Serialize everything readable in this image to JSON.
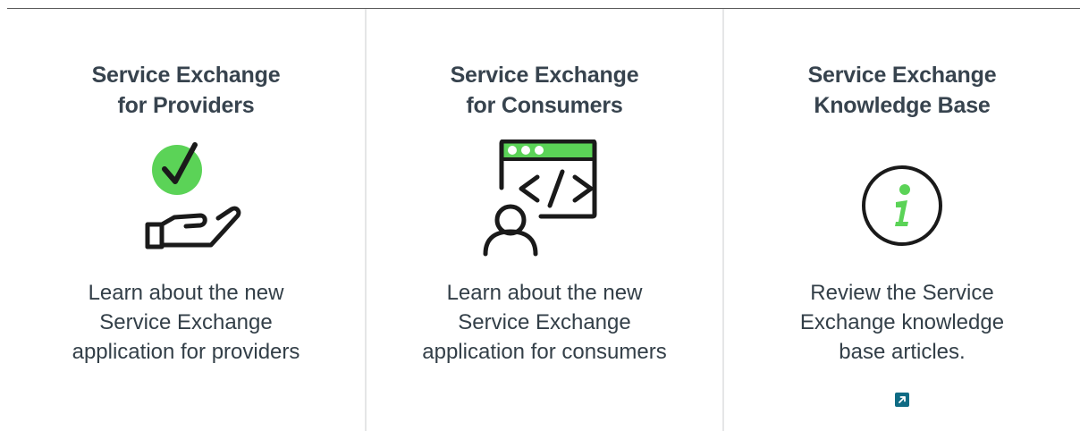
{
  "cards": [
    {
      "title_line1": "Service Exchange",
      "title_line2": "for Providers",
      "icon": "hand-checkmark-icon",
      "description_line1": "Learn about the new",
      "description_line2": "Service Exchange",
      "description_line3": "application for providers"
    },
    {
      "title_line1": "Service Exchange",
      "title_line2": "for Consumers",
      "icon": "code-window-user-icon",
      "description_line1": "Learn about the new",
      "description_line2": "Service Exchange",
      "description_line3": "application for consumers"
    },
    {
      "title_line1": "Service Exchange",
      "title_line2": "Knowledge Base",
      "icon": "info-icon",
      "description_line1": "Review the Service",
      "description_line2": "Exchange knowledge",
      "description_line3": "base articles.",
      "link_icon": "external-link-icon"
    }
  ],
  "colors": {
    "title": "#37434e",
    "text": "#333f48",
    "accent_green": "#5bd357",
    "icon_stroke": "#1a1a1a",
    "link": "#0f6b84",
    "divider": "#e5e6e7"
  }
}
